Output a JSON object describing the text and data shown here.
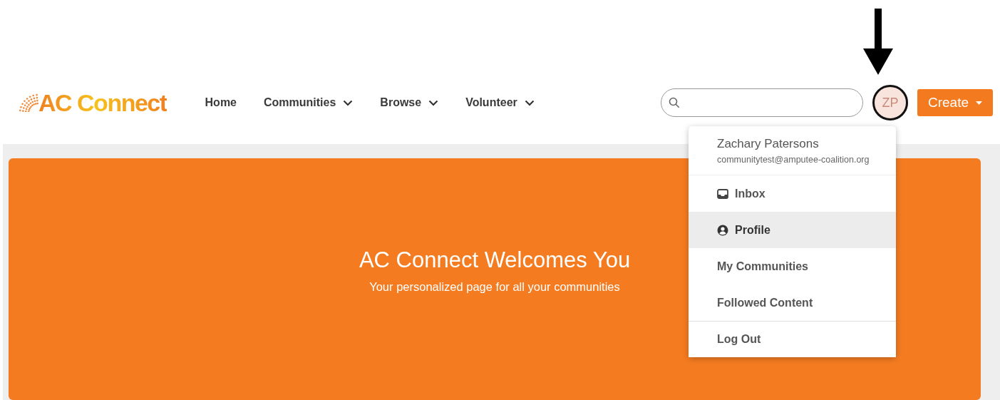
{
  "logo": {
    "text": "AC Connect"
  },
  "nav": [
    {
      "label": "Home",
      "has_menu": false
    },
    {
      "label": "Communities",
      "has_menu": true
    },
    {
      "label": "Browse",
      "has_menu": true
    },
    {
      "label": "Volunteer",
      "has_menu": true
    }
  ],
  "avatar": {
    "initials": "ZP",
    "highlighted": true
  },
  "create_button": {
    "label": "Create"
  },
  "user_menu": {
    "name": "Zachary Patersons",
    "email": "communitytest@amputee-coalition.org",
    "items": [
      {
        "label": "Inbox",
        "kind": "tray",
        "selected": false,
        "divider_before": false
      },
      {
        "label": "Profile",
        "kind": "person",
        "selected": true,
        "divider_before": false
      },
      {
        "label": "My Communities",
        "kind": "plain",
        "selected": false,
        "divider_before": false
      },
      {
        "label": "Followed Content",
        "kind": "plain",
        "selected": false,
        "divider_before": false
      },
      {
        "label": "Log Out",
        "kind": "plain",
        "selected": false,
        "divider_before": true
      }
    ]
  },
  "hero": {
    "title": "AC Connect Welcomes You",
    "subtitle": "Your personalized page for all your communities"
  }
}
